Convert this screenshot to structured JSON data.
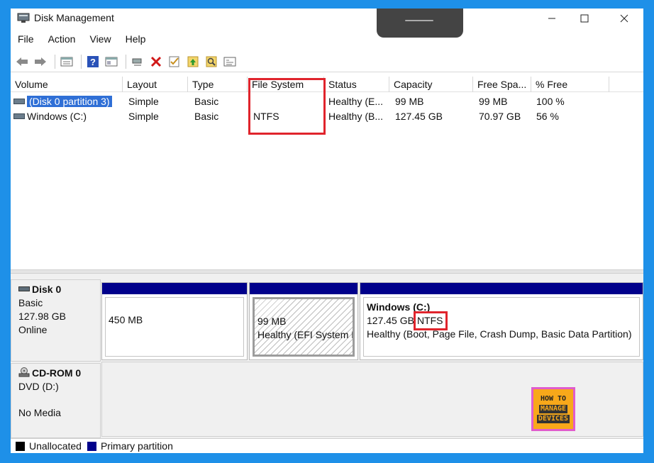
{
  "window": {
    "title": "Disk Management",
    "controls": {
      "minimize": "—",
      "maximize": "☐",
      "close": "✕"
    }
  },
  "menu": [
    "File",
    "Action",
    "View",
    "Help"
  ],
  "toolbar_icons": [
    "back-icon",
    "forward-icon",
    "properties-list-icon",
    "help-icon",
    "show-hide-pane-icon",
    "connect-icon",
    "delete-icon",
    "check-icon",
    "rescan-icon",
    "search-icon",
    "refresh-icon"
  ],
  "volume_list": {
    "columns": [
      "Volume",
      "Layout",
      "Type",
      "File System",
      "Status",
      "Capacity",
      "Free Spa...",
      "% Free"
    ],
    "rows": [
      {
        "volume": "(Disk 0 partition 3)",
        "layout": "Simple",
        "type": "Basic",
        "file_system": "",
        "status": "Healthy (E...",
        "capacity": "99 MB",
        "free_space": "99 MB",
        "pct_free": "100 %",
        "selected": true
      },
      {
        "volume": "Windows (C:)",
        "layout": "Simple",
        "type": "Basic",
        "file_system": "NTFS",
        "status": "Healthy (B...",
        "capacity": "127.45 GB",
        "free_space": "70.97 GB",
        "pct_free": "56 %",
        "selected": false
      }
    ]
  },
  "disks": [
    {
      "name": "Disk 0",
      "type": "Basic",
      "size": "127.98 GB",
      "state": "Online",
      "partitions": [
        {
          "title": "",
          "size": "450 MB",
          "status": ""
        },
        {
          "title": "",
          "size": "99 MB",
          "status": "Healthy (EFI System P"
        },
        {
          "title": "Windows  (C:)",
          "size": "127.45 GB",
          "fs": "NTFS",
          "status": "Healthy (Boot, Page File, Crash Dump, Basic Data Partition)"
        }
      ]
    },
    {
      "name": "CD-ROM 0",
      "type": "DVD (D:)",
      "state": "No Media"
    }
  ],
  "legend": [
    {
      "label": "Unallocated",
      "color": "#000000"
    },
    {
      "label": "Primary partition",
      "color": "#00008b"
    }
  ],
  "watermark": {
    "line1": "HOW TO",
    "line2": "MANAGE",
    "line3": "DEVICES"
  },
  "colors": {
    "accent": "#1e90e8",
    "highlight": "#e0242c",
    "partition_bar": "#00008b",
    "selection": "#2f6fd6"
  }
}
